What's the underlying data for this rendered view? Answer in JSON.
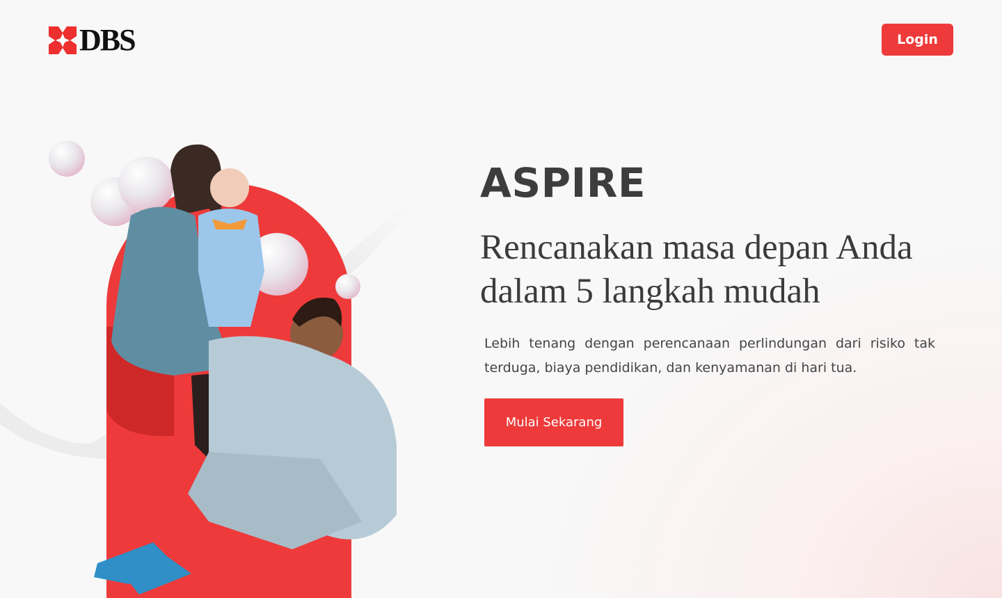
{
  "header": {
    "logo_text": "DBS",
    "login_label": "Login"
  },
  "hero": {
    "title": "ASPIRE",
    "subtitle_line1": "Rencanakan masa depan Anda",
    "subtitle_line2": "dalam 5 langkah mudah",
    "description": "Lebih tenang dengan perencanaan perlindungan dari risiko tak terduga,  biaya pendidikan, dan kenyamanan di hari tua.",
    "cta_label": "Mulai Sekarang"
  },
  "icons": {
    "logo": "dbs-star-icon"
  },
  "colors": {
    "brand_red": "#ee3a3a",
    "dark_red": "#cf2828",
    "text_dark": "#3d3d3d",
    "background": "#f8f8f8"
  }
}
